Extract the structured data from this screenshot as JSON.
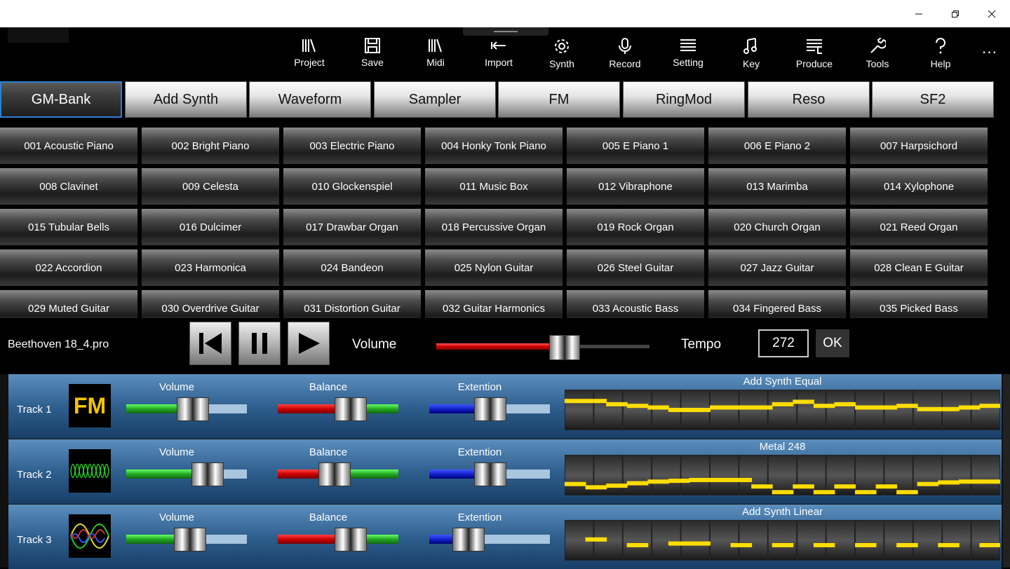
{
  "window": {
    "minimize_icon": "minimize-icon",
    "restore_icon": "restore-icon",
    "close_icon": "close-icon"
  },
  "toolbar": {
    "items": [
      {
        "label": "Project",
        "icon": "library-icon"
      },
      {
        "label": "Save",
        "icon": "floppy-icon"
      },
      {
        "label": "Midi",
        "icon": "library-icon"
      },
      {
        "label": "Import",
        "icon": "import-arrow-icon"
      },
      {
        "label": "Synth",
        "icon": "gear-icon"
      },
      {
        "label": "Record",
        "icon": "microphone-icon"
      },
      {
        "label": "Setting",
        "icon": "list-icon"
      },
      {
        "label": "Key",
        "icon": "music-note-icon"
      },
      {
        "label": "Produce",
        "icon": "document-icon"
      },
      {
        "label": "Tools",
        "icon": "wrench-icon"
      },
      {
        "label": "Help",
        "icon": "question-icon"
      }
    ],
    "more": "..."
  },
  "tabs": [
    "GM-Bank",
    "Add Synth",
    "Waveform",
    "Sampler",
    "FM",
    "RingMod",
    "Reso",
    "SF2"
  ],
  "active_tab": "GM-Bank",
  "instruments": [
    "001 Acoustic Piano",
    "002 Bright Piano",
    "003 Electric Piano",
    "004 Honky Tonk Piano",
    "005 E Piano 1",
    "006 E Piano 2",
    "007 Harpsichord",
    "008 Clavinet",
    "009 Celesta",
    "010 Glockenspiel",
    "011 Music Box",
    "012 Vibraphone",
    "013 Marimba",
    "014 Xylophone",
    "015 Tubular Bells",
    "016 Dulcimer",
    "017 Drawbar Organ",
    "018 Percussive Organ",
    "019 Rock Organ",
    "020 Church Organ",
    "021 Reed Organ",
    "022 Accordion",
    "023 Harmonica",
    "024 Bandeon",
    "025 Nylon Guitar",
    "026 Steel Guitar",
    "027 Jazz Guitar",
    "028 Clean E Guitar",
    "029 Muted Guitar",
    "030 Overdrive Guitar",
    "031 Distortion Guitar",
    "032 Guitar Harmonics",
    "033 Acoustic Bass",
    "034 Fingered Bass",
    "035 Picked Bass"
  ],
  "transport": {
    "filename": "Beethoven 18_4.pro",
    "volume_label": "Volume",
    "volume_level": 0.62,
    "tempo_label": "Tempo",
    "tempo_value": "272",
    "ok_label": "OK"
  },
  "tracks": [
    {
      "name": "Track 1",
      "thumb": "FM",
      "thumb_icon": "fm-icon",
      "volume_label": "Volume",
      "balance_label": "Balance",
      "extention_label": "Extention",
      "volume": 0.57,
      "balance": 0.64,
      "extention": 0.51,
      "wave_title": "Add Synth Equal"
    },
    {
      "name": "Track 2",
      "thumb": "",
      "thumb_icon": "waveform-icon",
      "volume_label": "Volume",
      "balance_label": "Balance",
      "extention_label": "Extention",
      "volume": 0.74,
      "balance": 0.46,
      "extention": 0.51,
      "wave_title": "Metal 248"
    },
    {
      "name": "Track 3",
      "thumb": "",
      "thumb_icon": "sine-waves-icon",
      "volume_label": "Volume",
      "balance_label": "Balance",
      "extention_label": "Extention",
      "volume": 0.54,
      "balance": 0.64,
      "extention": 0.26,
      "wave_title": "Add Synth Linear"
    }
  ],
  "colors": {
    "volume": "#33cc33",
    "balance": "#dd1111",
    "extention": "#1122cc",
    "wave": "#ffdd00",
    "accent": "#2f7fd6"
  }
}
